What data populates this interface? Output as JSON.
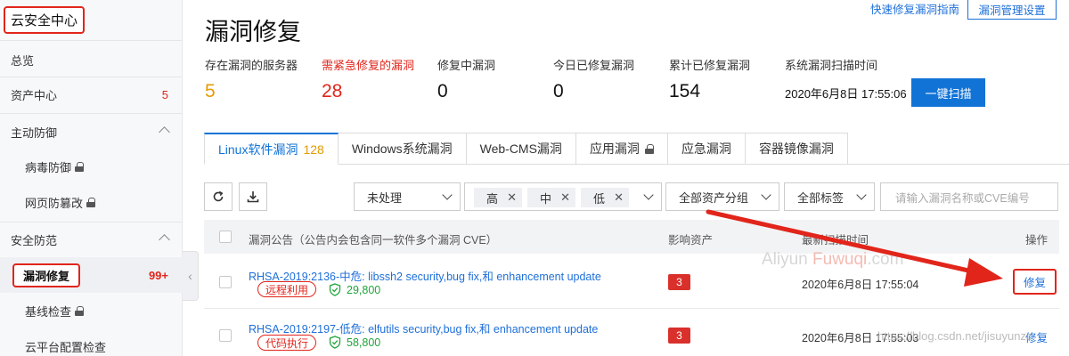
{
  "sidebar": {
    "brand": "云安全中心",
    "items": [
      {
        "label": "总览"
      },
      {
        "label": "资产中心",
        "count": "5"
      },
      {
        "label": "主动防御"
      },
      {
        "label": "病毒防御"
      },
      {
        "label": "网页防篡改"
      },
      {
        "label": "安全防范"
      },
      {
        "label": "漏洞修复",
        "count": "99+"
      },
      {
        "label": "基线检查"
      },
      {
        "label": "云平台配置检查"
      }
    ]
  },
  "header": {
    "title": "漏洞修复",
    "guide_link": "快速修复漏洞指南",
    "settings_button": "漏洞管理设置"
  },
  "stats": [
    {
      "label": "存在漏洞的服务器",
      "value": "5"
    },
    {
      "label": "需紧急修复的漏洞",
      "value": "28"
    },
    {
      "label": "修复中漏洞",
      "value": "0"
    },
    {
      "label": "今日已修复漏洞",
      "value": "0"
    },
    {
      "label": "累计已修复漏洞",
      "value": "154"
    },
    {
      "label": "系统漏洞扫描时间",
      "value": "2020年6月8日 17:55:06"
    }
  ],
  "scan_button": "一键扫描",
  "tabs": [
    {
      "label": "Linux软件漏洞",
      "count": "128"
    },
    {
      "label": "Windows系统漏洞"
    },
    {
      "label": "Web-CMS漏洞"
    },
    {
      "label": "应用漏洞"
    },
    {
      "label": "应急漏洞"
    },
    {
      "label": "容器镜像漏洞"
    }
  ],
  "filters": {
    "status": "未处理",
    "levels": [
      "高",
      "中",
      "低"
    ],
    "asset_group": "全部资产分组",
    "tags": "全部标签",
    "search_placeholder": "请输入漏洞名称或CVE编号"
  },
  "table": {
    "headers": {
      "name": "漏洞公告（公告内会包含同一软件多个漏洞 CVE）",
      "assets": "影响资产",
      "time": "最新扫描时间",
      "action": "操作"
    },
    "rows": [
      {
        "name": "RHSA-2019:2136-中危: libssh2 security,bug fix,和 enhancement update",
        "tag": "远程利用",
        "score": "29,800",
        "assets": "3",
        "time": "2020年6月8日 17:55:04",
        "action": "修复"
      },
      {
        "name": "RHSA-2019:2197-低危: elfutils security,bug fix,和 enhancement update",
        "tag": "代码执行",
        "score": "58,800",
        "assets": "3",
        "time": "2020年6月8日 17:55:03",
        "action": "修复"
      }
    ]
  },
  "watermark": {
    "part1": "Aliyun ",
    "part2": "Fuwuqi",
    "part3": ".com",
    "bottom": "https://blog.csdn.net/jisuyunzc"
  },
  "colors": {
    "accent": "#1173d6",
    "danger": "#e1251b",
    "warning": "#e69a00",
    "success": "#20a53a"
  }
}
